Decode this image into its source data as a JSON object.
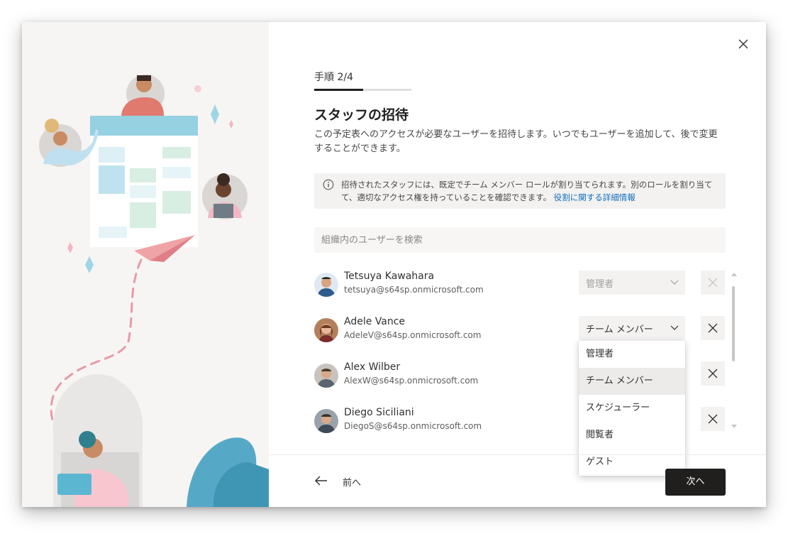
{
  "header": {
    "step_label": "手順 2/4",
    "progress": 0.5,
    "title": "スタッフの招待",
    "description": "この予定表へのアクセスが必要なユーザーを招待します。いつでもユーザーを追加して、後で変更することができます。"
  },
  "info": {
    "text": "招待されたスタッフには、既定でチーム メンバー ロールが割り当てられます。別のロールを割り当てて、適切なアクセス権を持っていることを確認できます。",
    "link": "役割に関する詳細情報",
    "icon": "info-icon"
  },
  "search": {
    "placeholder": "組織内のユーザーを検索"
  },
  "users": [
    {
      "name": "Tetsuya Kawahara",
      "email": "tetsuya@s64sp.onmicrosoft.com",
      "role": "管理者",
      "role_disabled": true
    },
    {
      "name": "Adele Vance",
      "email": "AdeleV@s64sp.onmicrosoft.com",
      "role": "チーム メンバー",
      "role_disabled": false
    },
    {
      "name": "Alex Wilber",
      "email": "AlexW@s64sp.onmicrosoft.com",
      "role": "",
      "role_disabled": false
    },
    {
      "name": "Diego Siciliani",
      "email": "DiegoS@s64sp.onmicrosoft.com",
      "role": "",
      "role_disabled": false
    }
  ],
  "role_dropdown": {
    "options": [
      "管理者",
      "チーム メンバー",
      "スケジューラー",
      "閲覧者",
      "ゲスト"
    ],
    "selected": "チーム メンバー"
  },
  "footer": {
    "back_label": "前へ",
    "next_label": "次へ"
  },
  "colors": {
    "primary_button": "#201f1e",
    "link": "#0f6cbd",
    "illustration_accent": "#95d1e0",
    "illustration_bg": "#f7f5f3"
  }
}
